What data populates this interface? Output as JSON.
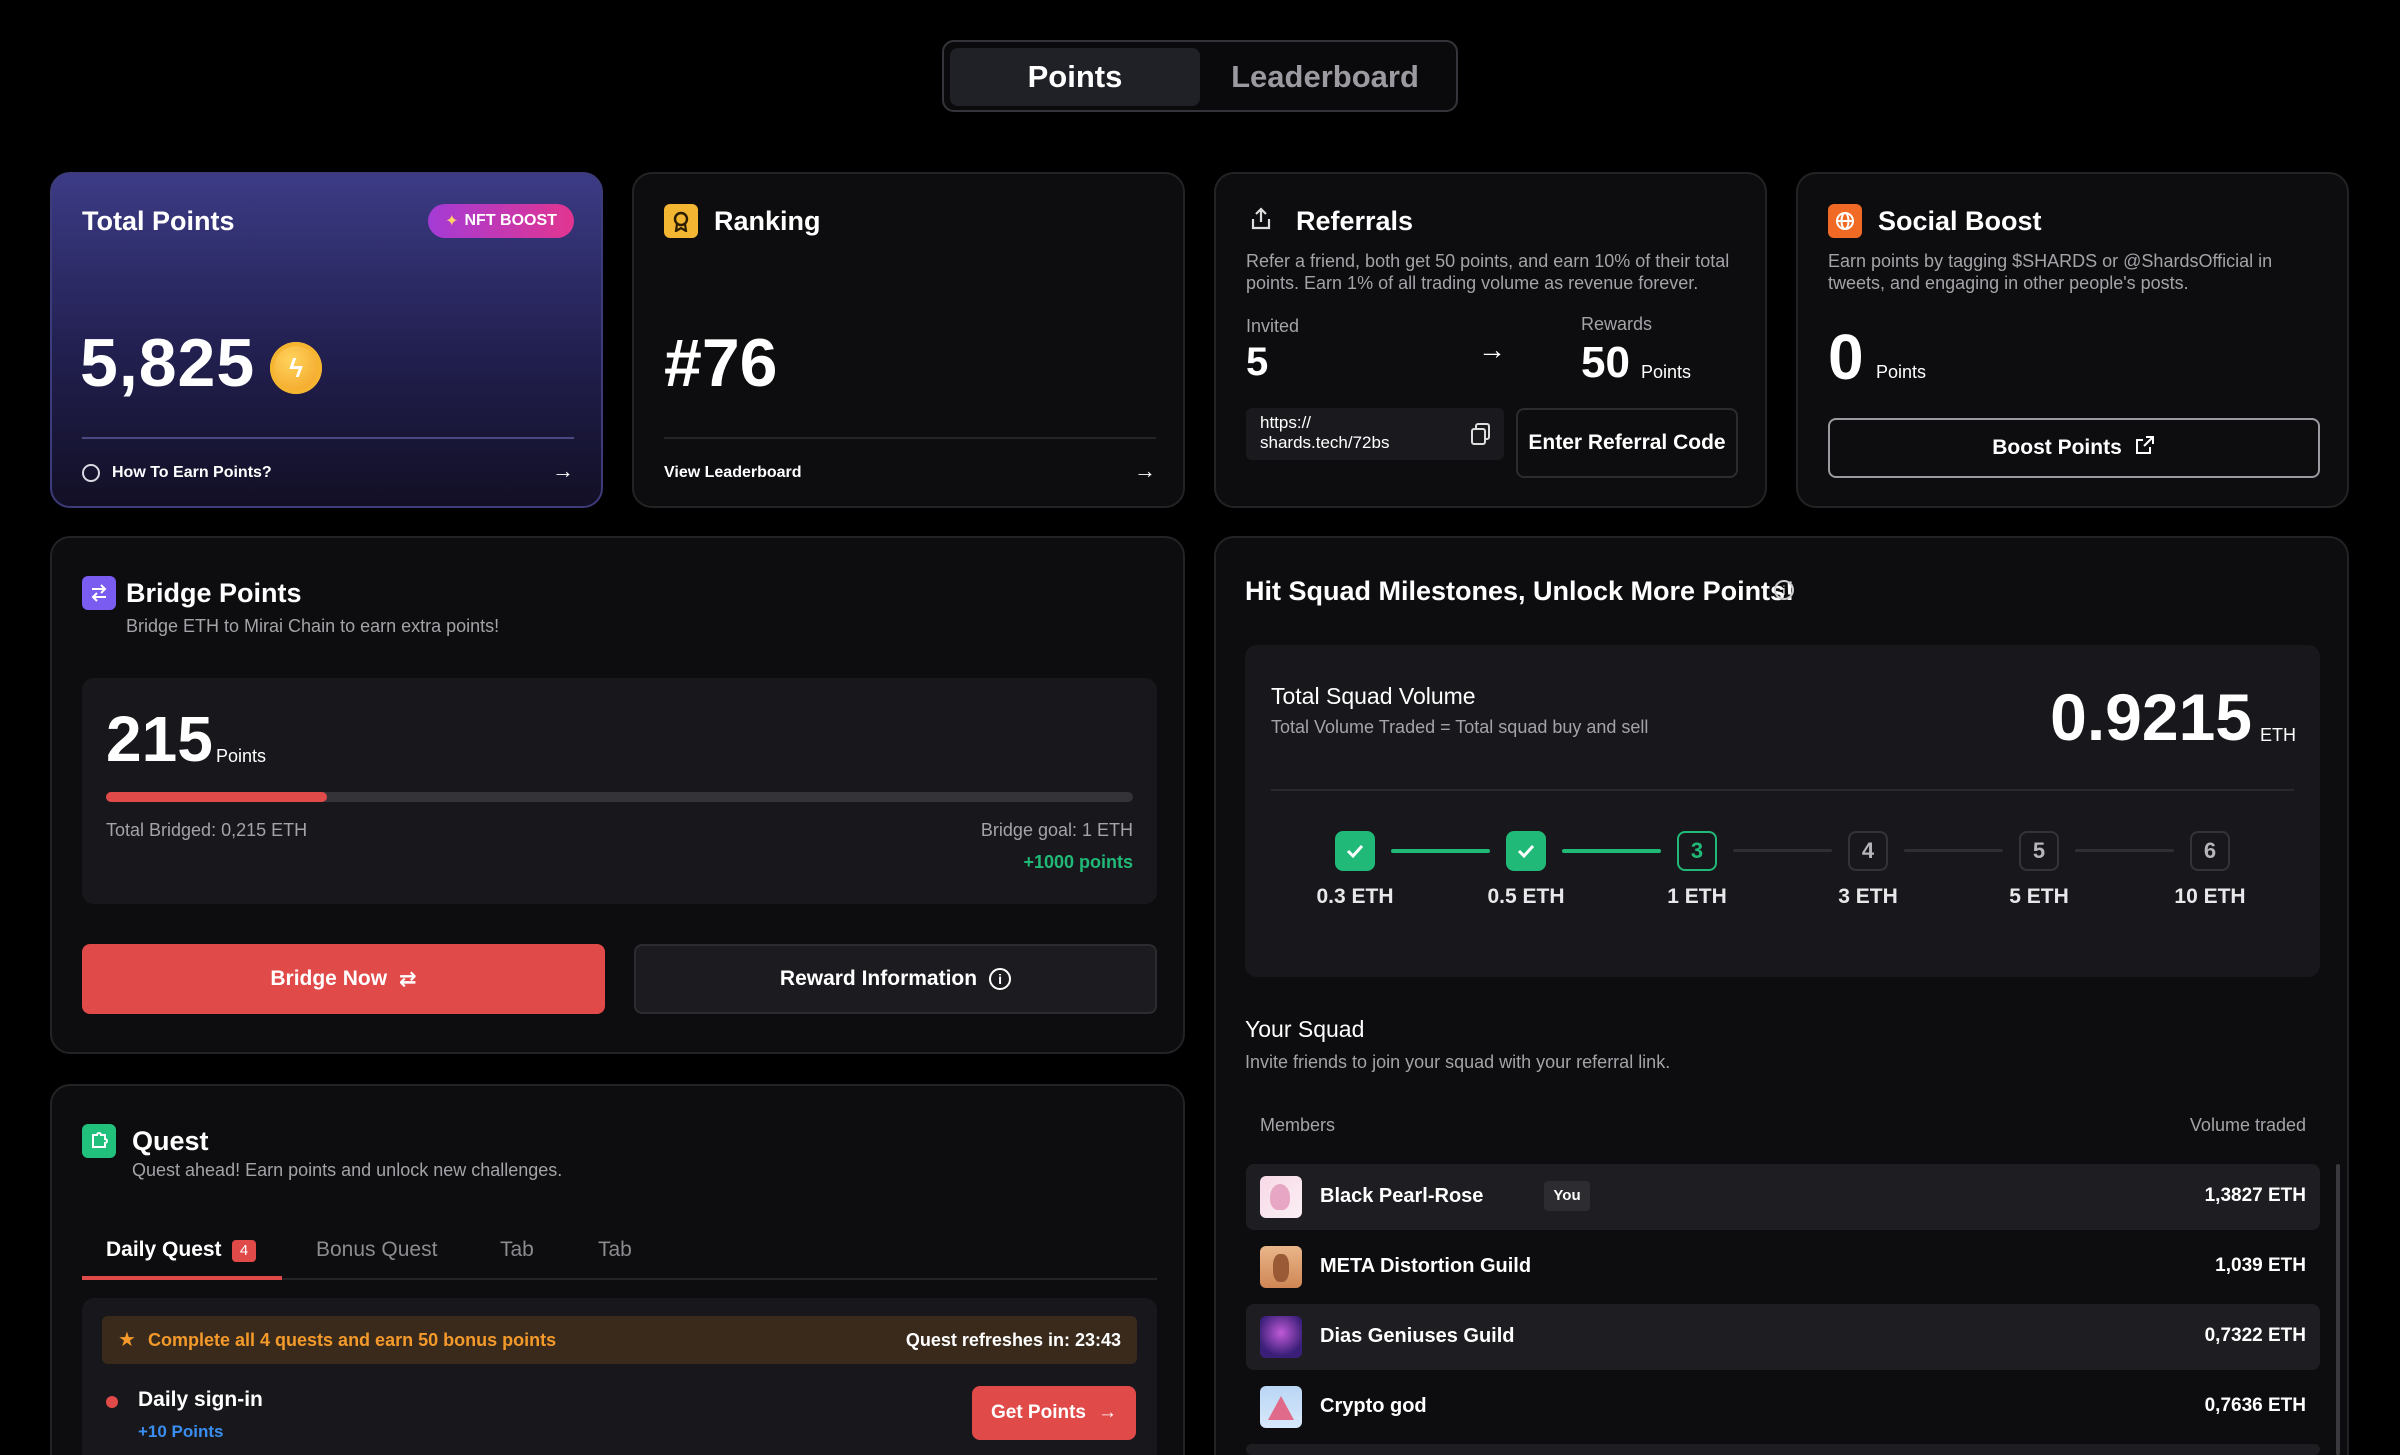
{
  "tabs": {
    "points": "Points",
    "leaderboard": "Leaderboard"
  },
  "total_points": {
    "title": "Total Points",
    "badge": "NFT BOOST",
    "value": "5,825",
    "link": "How To Earn Points?"
  },
  "ranking": {
    "title": "Ranking",
    "value": "#76",
    "link": "View Leaderboard"
  },
  "referrals": {
    "title": "Referrals",
    "desc": "Refer a friend, both get 50 points, and earn 10% of their total points. Earn 1% of all trading volume as revenue forever.",
    "invited_label": "Invited",
    "invited_value": "5",
    "rewards_label": "Rewards",
    "rewards_value": "50",
    "rewards_unit": "Points",
    "link": "https://\nshards.tech/72bs",
    "enter_code": "Enter Referral Code"
  },
  "social": {
    "title": "Social Boost",
    "desc": "Earn points by tagging $SHARDS or @ShardsOfficial in tweets, and engaging in other people's posts.",
    "value": "0",
    "unit": "Points",
    "button": "Boost Points"
  },
  "bridge": {
    "title": "Bridge Points",
    "subtitle": "Bridge ETH to Mirai Chain to earn extra points!",
    "value": "215",
    "unit": "Points",
    "progress": 0.215,
    "total_bridged": "Total Bridged: 0,215 ETH",
    "goal": "Bridge goal: 1 ETH",
    "bonus": "+1000 points",
    "bridge_button": "Bridge Now",
    "reward_button": "Reward Information"
  },
  "quest": {
    "title": "Quest",
    "subtitle": "Quest ahead! Earn points and unlock new challenges.",
    "tabs": [
      "Daily Quest",
      "Bonus Quest",
      "Tab",
      "Tab"
    ],
    "daily_count": "4",
    "banner": "Complete all 4 quests and earn 50 bonus points",
    "refresh": "Quest refreshes in: 23:43",
    "item_title": "Daily sign-in",
    "item_points": "+10 Points",
    "item_button": "Get Points"
  },
  "squad": {
    "title": "Hit Squad Milestones, Unlock More Points!",
    "volume_title": "Total Squad Volume",
    "volume_sub": "Total Volume Traded = Total squad buy and sell",
    "volume_value": "0.9215",
    "volume_unit": "ETH",
    "steps": [
      {
        "label": "0.3 ETH",
        "mark": "",
        "done": true
      },
      {
        "label": "0.5 ETH",
        "mark": "",
        "done": true
      },
      {
        "label": "1 ETH",
        "mark": "3",
        "done": false
      },
      {
        "label": "3 ETH",
        "mark": "4",
        "done": false
      },
      {
        "label": "5 ETH",
        "mark": "5",
        "done": false
      },
      {
        "label": "10 ETH",
        "mark": "6",
        "done": false
      }
    ],
    "your_squad": "Your Squad",
    "your_squad_sub": "Invite friends to join your squad with your referral link.",
    "col_members": "Members",
    "col_volume": "Volume traded",
    "you_tag": "You",
    "members": [
      {
        "name": "Black Pearl-Rose",
        "volume": "1,3827 ETH"
      },
      {
        "name": "META Distortion Guild",
        "volume": "1,039 ETH"
      },
      {
        "name": "Dias Geniuses Guild",
        "volume": "0,7322 ETH"
      },
      {
        "name": "Crypto god",
        "volume": "0,7636 ETH"
      }
    ]
  },
  "colors": {
    "accent_red": "#e04a48",
    "accent_green": "#21b977",
    "badge_pink": "#e2358f"
  }
}
